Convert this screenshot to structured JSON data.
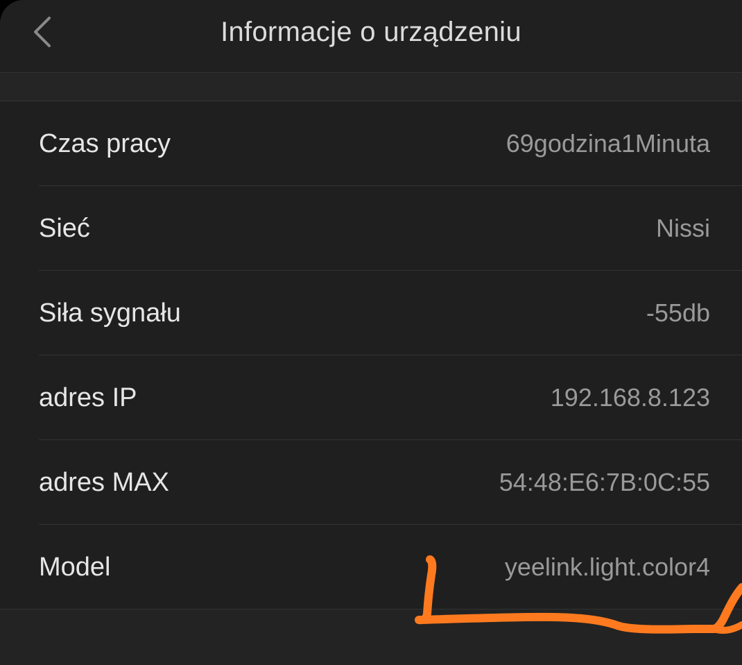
{
  "header": {
    "title": "Informacje o urządzeniu",
    "back_icon": "chevron-left-icon"
  },
  "rows": [
    {
      "label": "Czas pracy",
      "value": "69godzina1Minuta"
    },
    {
      "label": "Sieć",
      "value": "Nissi"
    },
    {
      "label": "Siła sygnału",
      "value": "-55db"
    },
    {
      "label": "adres IP",
      "value": "192.168.8.123"
    },
    {
      "label": "adres MAX",
      "value": "54:48:E6:7B:0C:55"
    },
    {
      "label": "Model",
      "value": "yeelink.light.color4"
    }
  ],
  "colors": {
    "background": "#222222",
    "list_background": "#1f1f1f",
    "label_text": "#e6e6e6",
    "value_text": "#9a9a9a",
    "annotation_stroke": "#ff7a1f"
  }
}
